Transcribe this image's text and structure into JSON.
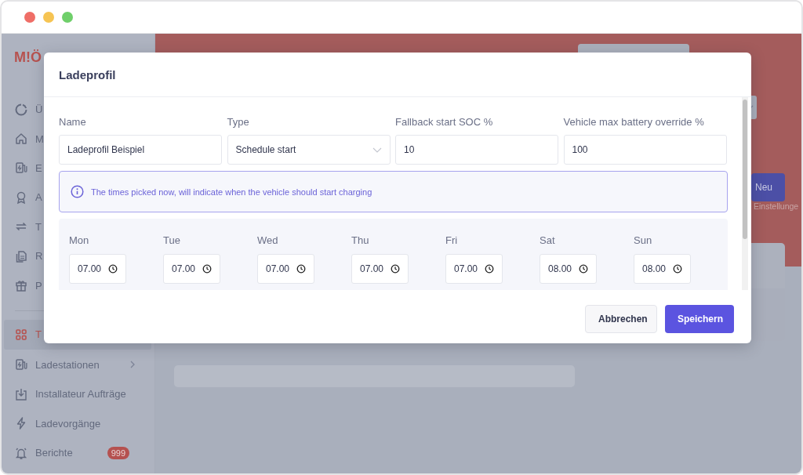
{
  "sidebar": {
    "logo": "M!Ö",
    "items": [
      {
        "label": "Ü",
        "selected": false,
        "has_submenu": false
      },
      {
        "label": "M",
        "selected": false,
        "has_submenu": false
      },
      {
        "label": "E",
        "selected": false,
        "has_submenu": false
      },
      {
        "label": "A",
        "selected": false,
        "has_submenu": false
      },
      {
        "label": "T",
        "selected": false,
        "has_submenu": false
      },
      {
        "label": "R",
        "selected": false,
        "has_submenu": false
      },
      {
        "label": "P",
        "selected": false,
        "has_submenu": false
      },
      {
        "label": "T",
        "selected": true,
        "has_submenu": false
      },
      {
        "label": "Ladestationen",
        "selected": false,
        "has_submenu": true
      },
      {
        "label": "Installateur Aufträge",
        "selected": false,
        "has_submenu": false
      },
      {
        "label": "Ladevorgänge",
        "selected": false,
        "has_submenu": false
      },
      {
        "label": "Berichte",
        "selected": false,
        "has_submenu": false,
        "badge": "999"
      }
    ]
  },
  "main": {
    "new_button": "Neu",
    "caption": "Einstellunge"
  },
  "modal": {
    "title": "Ladeprofil",
    "fields": [
      {
        "label": "Name",
        "value": "Ladeprofil Beispiel",
        "kind": "text"
      },
      {
        "label": "Type",
        "value": "Schedule start",
        "kind": "select"
      },
      {
        "label": "Fallback start SOC %",
        "value": "10",
        "kind": "text"
      },
      {
        "label": "Vehicle max battery override %",
        "value": "100",
        "kind": "text"
      }
    ],
    "info": "The times picked now, will indicate when the vehicle should start charging",
    "schedule": [
      {
        "day": "Mon",
        "time": "07.00"
      },
      {
        "day": "Tue",
        "time": "07.00"
      },
      {
        "day": "Wed",
        "time": "07.00"
      },
      {
        "day": "Thu",
        "time": "07.00"
      },
      {
        "day": "Fri",
        "time": "07.00"
      },
      {
        "day": "Sat",
        "time": "08.00"
      },
      {
        "day": "Sun",
        "time": "08.00"
      }
    ],
    "buttons": [
      {
        "label": "Abbrechen",
        "kind": "secondary"
      },
      {
        "label": "Speichern",
        "kind": "primary"
      }
    ]
  }
}
